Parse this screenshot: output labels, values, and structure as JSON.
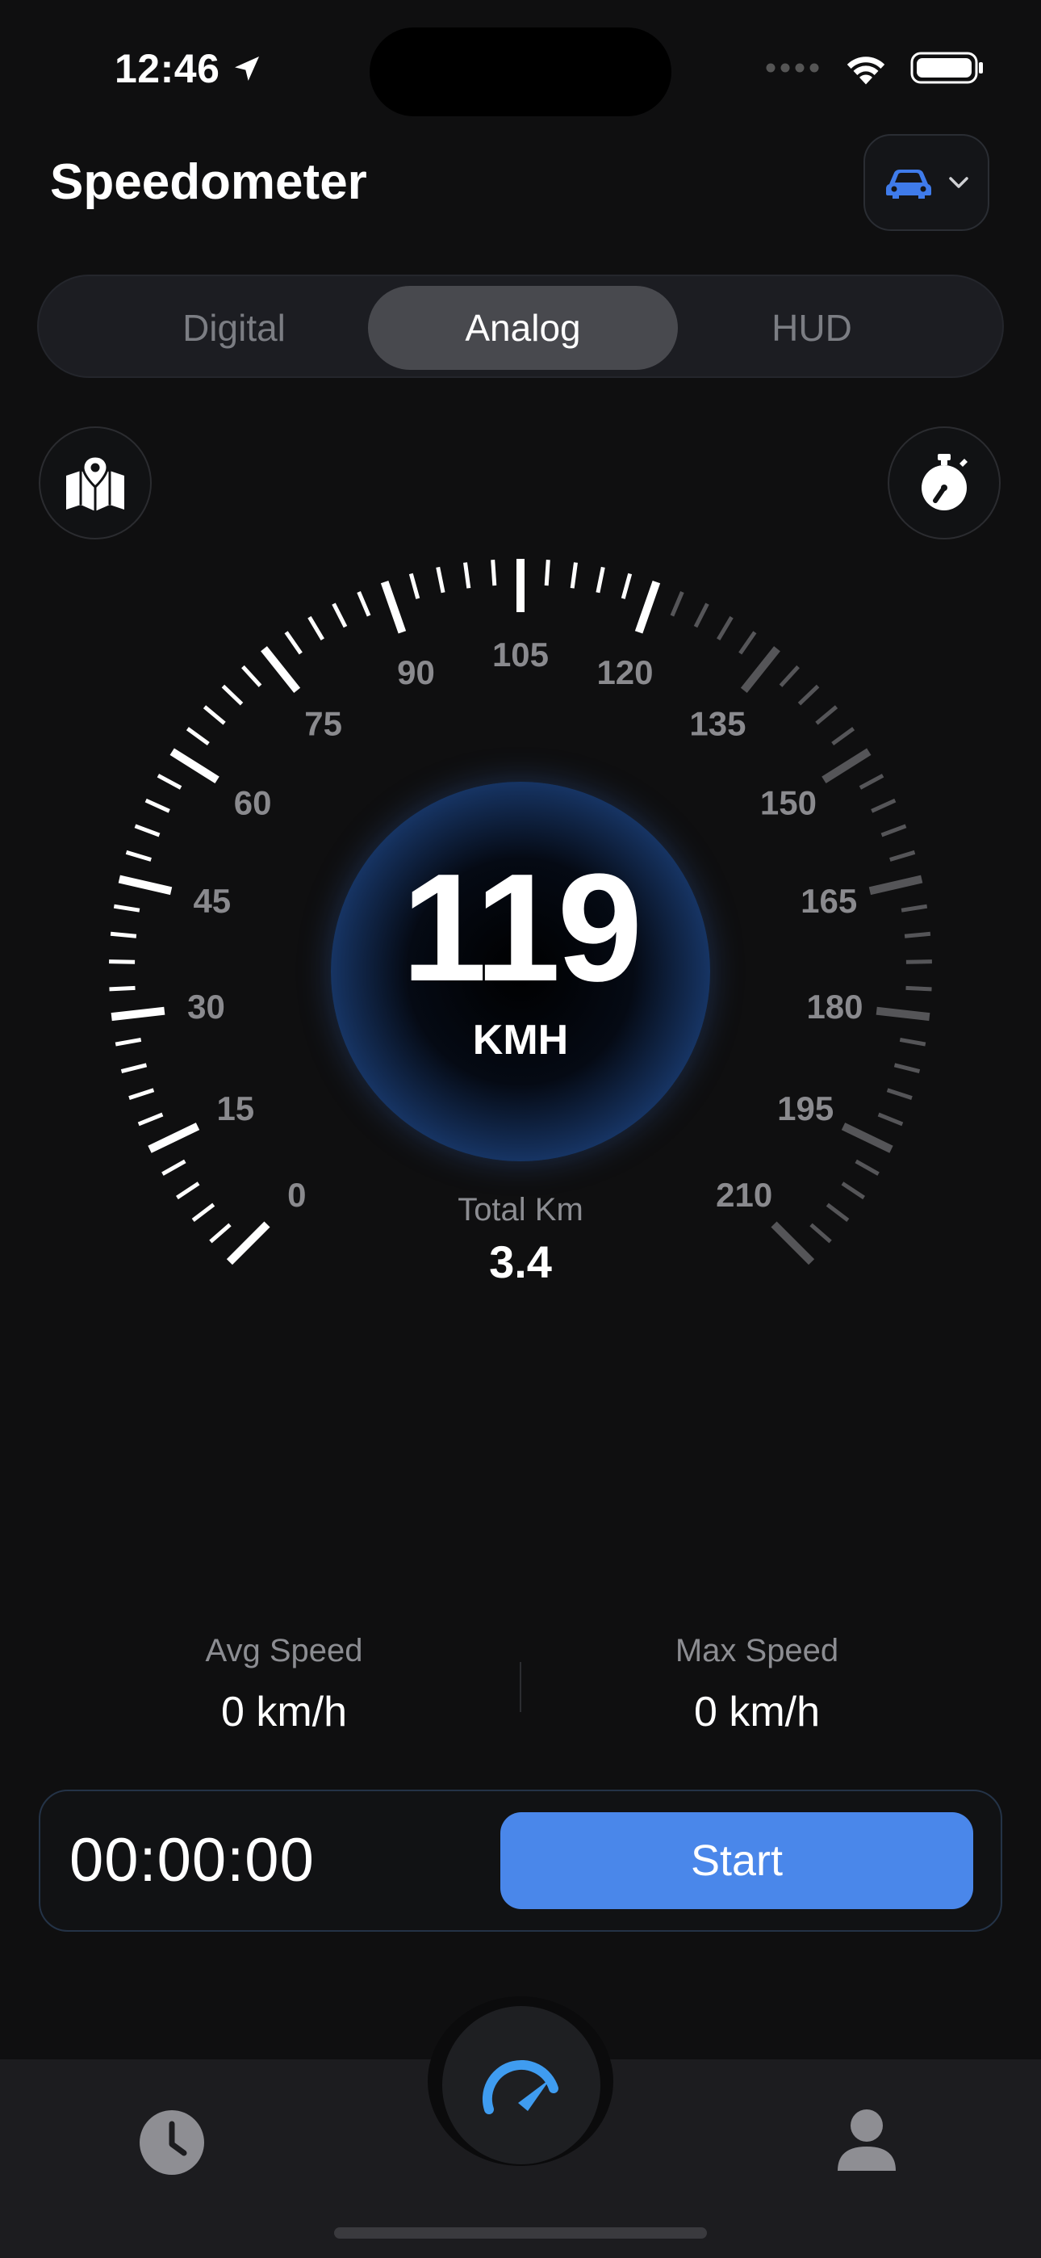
{
  "status_bar": {
    "time": "12:46"
  },
  "header": {
    "title": "Speedometer"
  },
  "mode_tabs": [
    {
      "label": "Digital",
      "active": false
    },
    {
      "label": "Analog",
      "active": true
    },
    {
      "label": "HUD",
      "active": false
    }
  ],
  "gauge": {
    "tick_labels": [
      "0",
      "15",
      "30",
      "45",
      "60",
      "75",
      "90",
      "105",
      "120",
      "135",
      "150",
      "165",
      "180",
      "195",
      "210"
    ],
    "current_speed": "119",
    "unit": "KMH",
    "speed_fraction": 0.567,
    "accent": "#3a6bc0"
  },
  "total": {
    "label": "Total Km",
    "value": "3.4"
  },
  "stats": {
    "avg": {
      "label": "Avg Speed",
      "value": "0 km/h"
    },
    "max": {
      "label": "Max Speed",
      "value": "0 km/h"
    }
  },
  "timer": {
    "elapsed": "00:00:00",
    "start_label": "Start"
  },
  "colors": {
    "accent_blue": "#4a87ea",
    "car_icon": "#3f7bea"
  },
  "icons": {
    "vehicle": "car-icon",
    "map": "map-pin-icon",
    "stopwatch": "stopwatch-icon",
    "history": "clock-icon",
    "speedometer": "speedometer-icon",
    "profile": "person-icon"
  }
}
